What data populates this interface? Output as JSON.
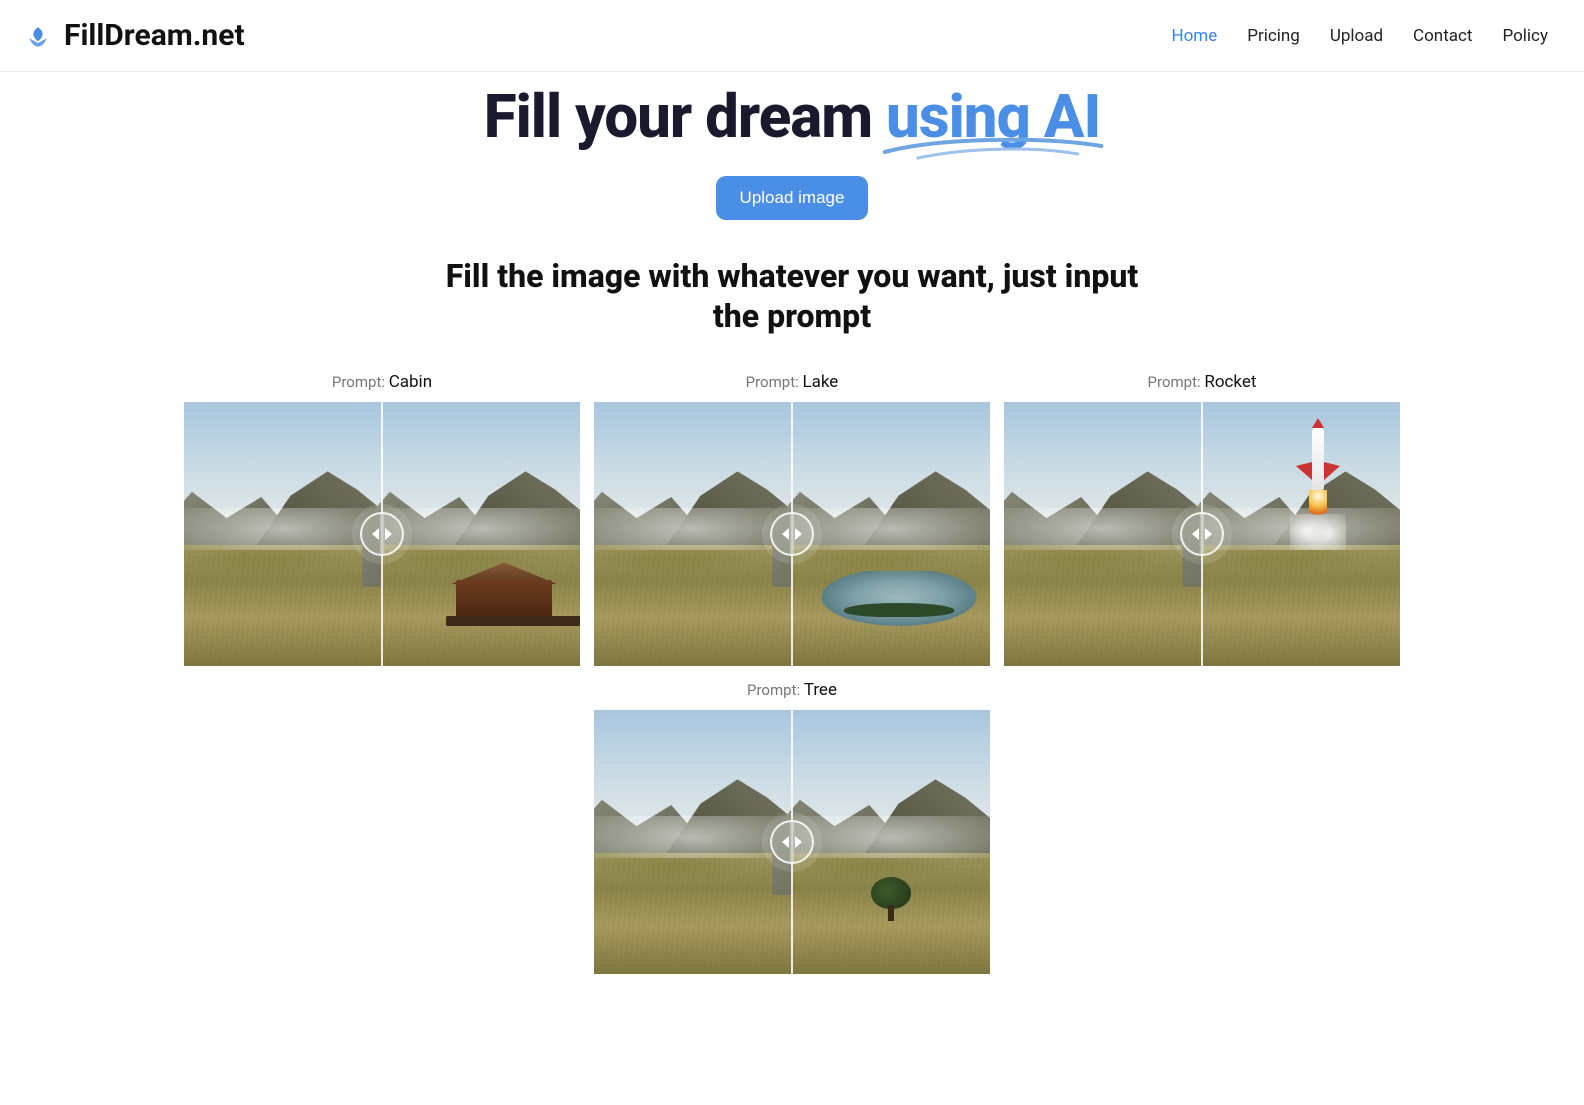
{
  "brand": {
    "name": "FillDream.net"
  },
  "nav": {
    "items": [
      {
        "label": "Home",
        "active": true
      },
      {
        "label": "Pricing",
        "active": false
      },
      {
        "label": "Upload",
        "active": false
      },
      {
        "label": "Contact",
        "active": false
      },
      {
        "label": "Policy",
        "active": false
      }
    ]
  },
  "hero": {
    "headline_pre": "Fill your dream ",
    "headline_accent": "using AI",
    "cta": "Upload image"
  },
  "sub_headline": "Fill the image with whatever you want, just input the prompt",
  "prompt_label": "Prompt: ",
  "examples": [
    {
      "value": "Cabin",
      "feature": "cabin"
    },
    {
      "value": "Lake",
      "feature": "lake"
    },
    {
      "value": "Rocket",
      "feature": "rocket"
    },
    {
      "value": "Tree",
      "feature": "tree"
    }
  ],
  "colors": {
    "accent": "#4a8ee6",
    "text": "#111"
  }
}
